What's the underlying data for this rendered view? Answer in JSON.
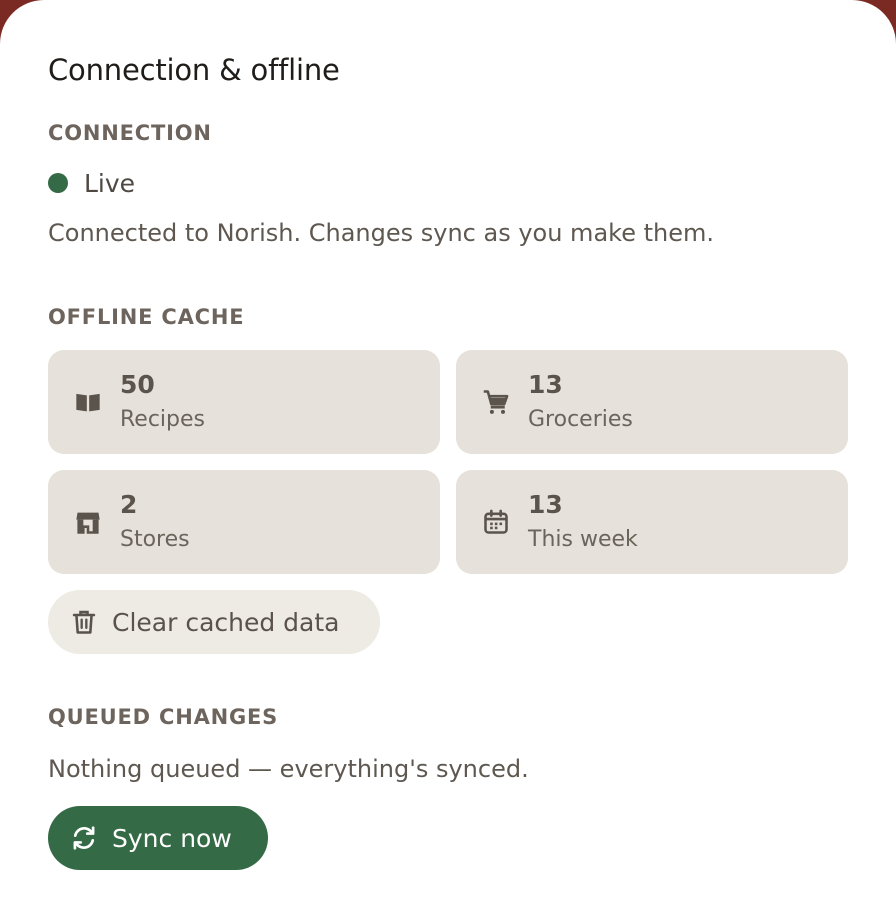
{
  "title": "Connection & offline",
  "connection": {
    "label": "CONNECTION",
    "status": "Live",
    "status_color": "#346a45",
    "description": "Connected to Norish. Changes sync as you make them."
  },
  "offline_cache": {
    "label": "OFFLINE CACHE",
    "tiles": [
      {
        "value": "50",
        "label": "Recipes",
        "icon": "book-icon"
      },
      {
        "value": "13",
        "label": "Groceries",
        "icon": "cart-icon"
      },
      {
        "value": "2",
        "label": "Stores",
        "icon": "store-icon"
      },
      {
        "value": "13",
        "label": "This week",
        "icon": "calendar-icon"
      }
    ],
    "clear_button": "Clear cached data"
  },
  "queued": {
    "label": "QUEUED CHANGES",
    "description": "Nothing queued — everything's synced.",
    "sync_button": "Sync now"
  },
  "colors": {
    "accent": "#346a45",
    "tile_bg": "#e6e1da"
  }
}
